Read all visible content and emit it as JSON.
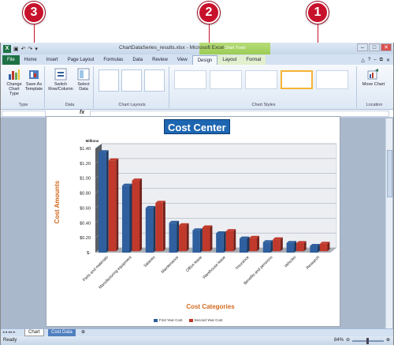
{
  "window": {
    "title": "ChartDataSeries_results.xlsx - Microsoft Excel",
    "context_title": "Chart Tools"
  },
  "callouts": [
    "3",
    "2",
    "1"
  ],
  "tabs": [
    "File",
    "Home",
    "Insert",
    "Page Layout",
    "Formulas",
    "Data",
    "Review",
    "View",
    "Design",
    "Layout",
    "Format"
  ],
  "ribbon": {
    "change_chart_type": "Change Chart Type",
    "save_as_template": "Save As Template",
    "type_group": "Type",
    "switch_row_column": "Switch Row/Column",
    "select_data": "Select Data",
    "data_group": "Data",
    "chart_layouts_group": "Chart Layouts",
    "chart_styles_group": "Chart Styles",
    "move_chart": "Move Chart",
    "location_group": "Location"
  },
  "formula_bar": {
    "fx": "fx"
  },
  "chart_data": {
    "type": "bar",
    "title": "Cost Center",
    "xlabel": "Cost Categories",
    "ylabel": "Cost Amounts",
    "units_label": "Millions",
    "categories": [
      "Parts and materials",
      "Manufacturing equipment",
      "Salaries",
      "Maintenance",
      "Office lease",
      "Warehouse lease",
      "Insurance",
      "Benefits and pensions",
      "Vehicles",
      "Research"
    ],
    "series": [
      {
        "name": "First Year Cost",
        "color": "#2f5f9e",
        "values": [
          1.35,
          0.9,
          0.6,
          0.4,
          0.3,
          0.26,
          0.19,
          0.14,
          0.13,
          0.09
        ]
      },
      {
        "name": "Second Year Cost",
        "color": "#c0392b",
        "values": [
          1.22,
          0.95,
          0.65,
          0.35,
          0.32,
          0.27,
          0.18,
          0.16,
          0.11,
          0.1
        ]
      }
    ],
    "yticks": [
      "$1.40",
      "$1.20",
      "$1.00",
      "$0.80",
      "$0.60",
      "$0.40",
      "$0.20",
      "$-"
    ],
    "ylim": [
      0,
      1.4
    ],
    "grid": true,
    "legend_position": "bottom"
  },
  "sheet_tabs": [
    "Chart",
    "Cost Data"
  ],
  "status": {
    "ready": "Ready",
    "zoom": "84%"
  },
  "colors": {
    "excel_green": "#1e7145",
    "callout_red": "#c8112b",
    "title_blue": "#1d66b1",
    "axis_title_orange": "#d2691e"
  }
}
